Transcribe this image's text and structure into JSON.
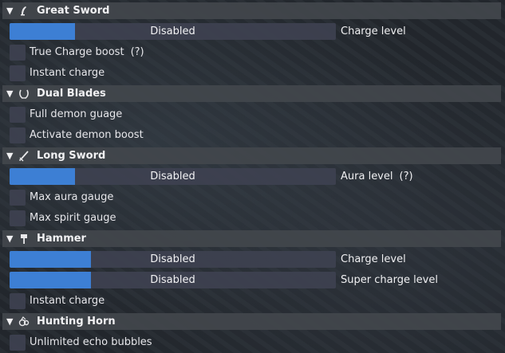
{
  "sections": {
    "great_sword": {
      "title": "Great Sword",
      "charge_slider": {
        "value_text": "Disabled",
        "label": "Charge level",
        "fill_fraction": 0.2
      },
      "true_charge_boost": "True Charge boost",
      "true_charge_help": "(?)",
      "instant_charge": "Instant charge"
    },
    "dual_blades": {
      "title": "Dual Blades",
      "full_demon_gauge": "Full demon guage",
      "activate_demon_boost": "Activate demon boost"
    },
    "long_sword": {
      "title": "Long Sword",
      "aura_slider": {
        "value_text": "Disabled",
        "label": "Aura level",
        "fill_fraction": 0.2
      },
      "aura_help": "(?)",
      "max_aura_gauge": "Max aura gauge",
      "max_spirit_gauge": "Max spirit gauge"
    },
    "hammer": {
      "title": "Hammer",
      "charge_slider": {
        "value_text": "Disabled",
        "label": "Charge level",
        "fill_fraction": 0.25
      },
      "super_charge_slider": {
        "value_text": "Disabled",
        "label": "Super charge level",
        "fill_fraction": 0.25
      },
      "instant_charge": "Instant charge"
    },
    "hunting_horn": {
      "title": "Hunting Horn",
      "unlimited_echo_bubbles": "Unlimited echo bubbles"
    }
  },
  "colors": {
    "accent": "#3d7fd4",
    "frame": "#3e4150",
    "header": "#42464c"
  },
  "icons": {
    "collapse": "triangle-down-icon",
    "great_sword": "great-sword-icon",
    "dual_blades": "dual-blades-icon",
    "long_sword": "long-sword-icon",
    "hammer": "hammer-icon",
    "hunting_horn": "hunting-horn-icon"
  }
}
